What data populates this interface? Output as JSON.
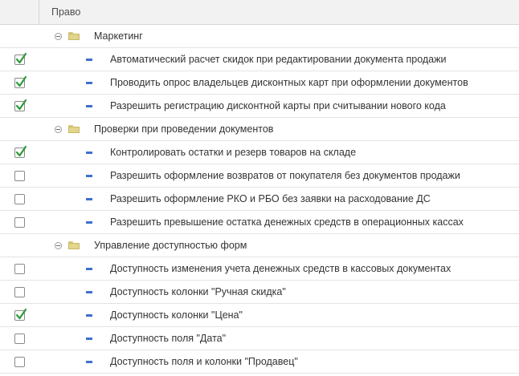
{
  "header": {
    "title": "Право"
  },
  "rows": [
    {
      "type": "group",
      "label": "Маркетинг"
    },
    {
      "type": "item",
      "label": "Автоматический расчет скидок при редактировании документа продажи",
      "checked": true
    },
    {
      "type": "item",
      "label": "Проводить опрос владельцев дисконтных карт при оформлении документов",
      "checked": true
    },
    {
      "type": "item",
      "label": "Разрешить регистрацию дисконтной карты при считывании нового кода",
      "checked": true
    },
    {
      "type": "group",
      "label": "Проверки при проведении документов"
    },
    {
      "type": "item",
      "label": "Контролировать остатки и резерв товаров на складе",
      "checked": true
    },
    {
      "type": "item",
      "label": "Разрешить оформление возвратов от покупателя без документов продажи",
      "checked": false
    },
    {
      "type": "item",
      "label": "Разрешить оформление РКО и РБО без заявки на расходование ДС",
      "checked": false
    },
    {
      "type": "item",
      "label": "Разрешить превышение остатка денежных средств в операционных кассах",
      "checked": false
    },
    {
      "type": "group",
      "label": "Управление доступностью форм"
    },
    {
      "type": "item",
      "label": "Доступность изменения учета денежных средств в кассовых документах",
      "checked": false
    },
    {
      "type": "item",
      "label": "Доступность колонки \"Ручная скидка\"",
      "checked": false
    },
    {
      "type": "item",
      "label": "Доступность колонки \"Цена\"",
      "checked": true
    },
    {
      "type": "item",
      "label": "Доступность поля \"Дата\"",
      "checked": false
    },
    {
      "type": "item",
      "label": "Доступность поля и колонки \"Продавец\"",
      "checked": false
    }
  ],
  "icons": {
    "group_toggle": "collapse-icon",
    "group_folder": "folder-icon",
    "item_marker": "dash-icon",
    "check": "checkmark-icon"
  },
  "colors": {
    "check": "#2e9a3a",
    "item_marker": "#3f6fd0",
    "folder": "#e2d58c"
  }
}
